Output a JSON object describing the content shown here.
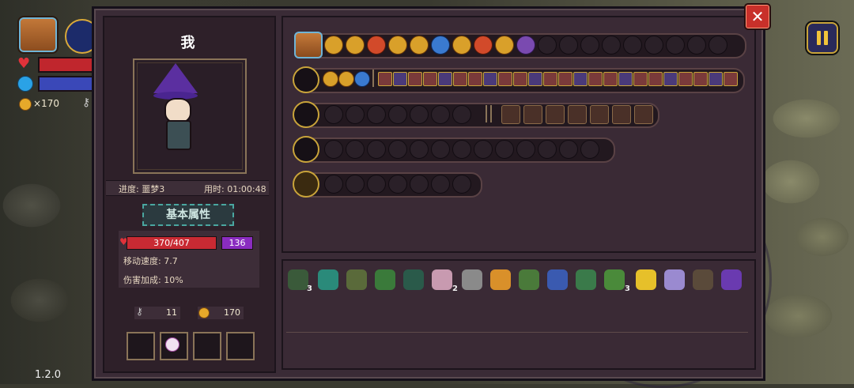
{
  "player_name": "我",
  "progress_label": "进度: 噩梦3",
  "time_label": "用时: 01:00:48",
  "attributes_button": "基本属性",
  "stats": {
    "hp": "370/407",
    "shield": "136",
    "move_speed": "移动速度: 7.7",
    "damage_bonus": "伤害加成: 10%"
  },
  "counters": {
    "keys": "11",
    "coins": "170"
  },
  "hud": {
    "coins": "×170"
  },
  "version": "1.2.0",
  "close_label": "✕",
  "item_quantities": {
    "item1": "3",
    "item6": "2",
    "item13": "3"
  },
  "colors": {
    "panel_bg": "#3a2b36",
    "gold_accent": "#c9a43a",
    "hp_red": "#c92a33",
    "shield_purple": "#8a2cc0"
  }
}
